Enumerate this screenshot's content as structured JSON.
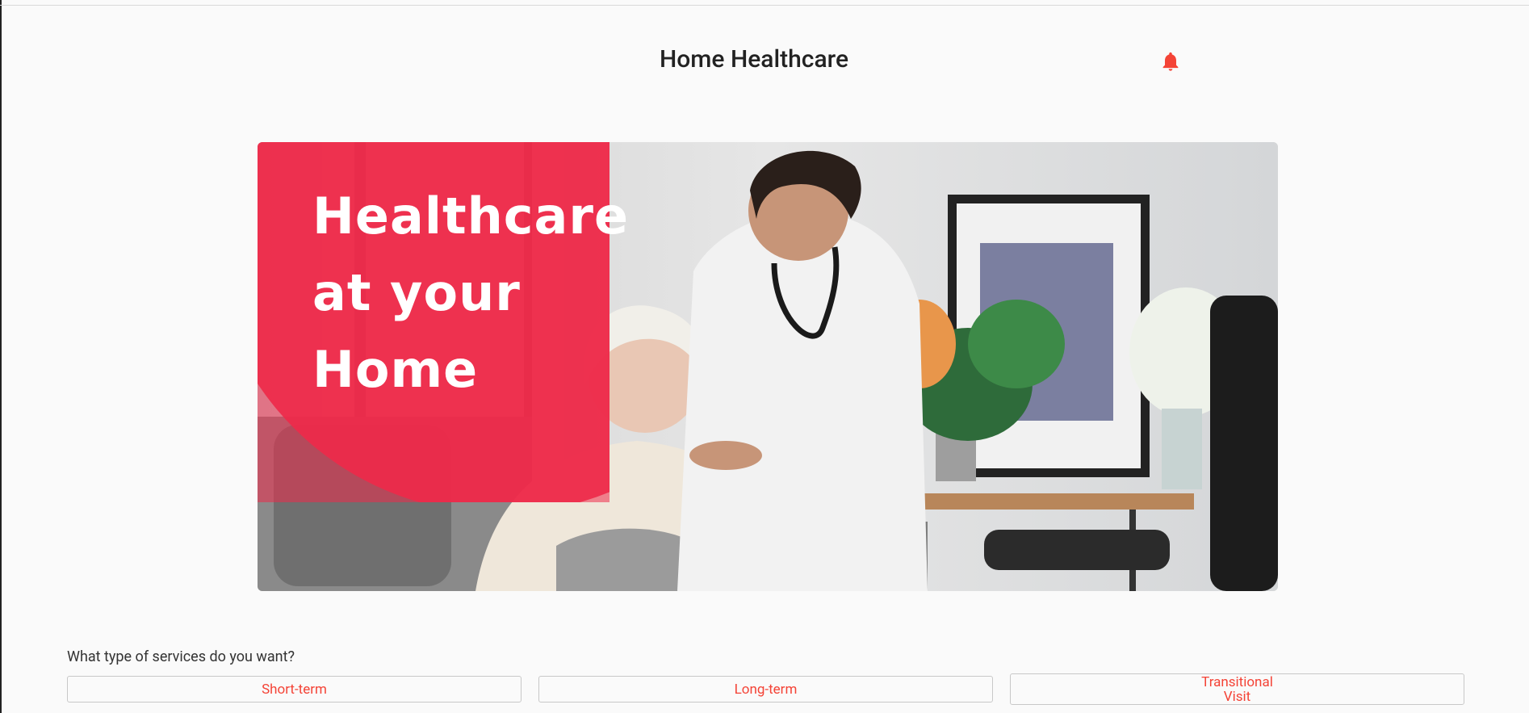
{
  "header": {
    "title": "Home Healthcare",
    "notification_icon": "bell-icon",
    "accent_color": "#f44336"
  },
  "banner": {
    "headline_lines": [
      "Healthcare",
      "at your",
      "Home"
    ],
    "overlay_color": "#ee2a4a"
  },
  "services": {
    "question": "What type of services do you want?",
    "options": [
      {
        "label": "Short-term"
      },
      {
        "label": "Long-term"
      },
      {
        "label_line1": "Transitional",
        "label_line2": "Visit"
      }
    ]
  }
}
